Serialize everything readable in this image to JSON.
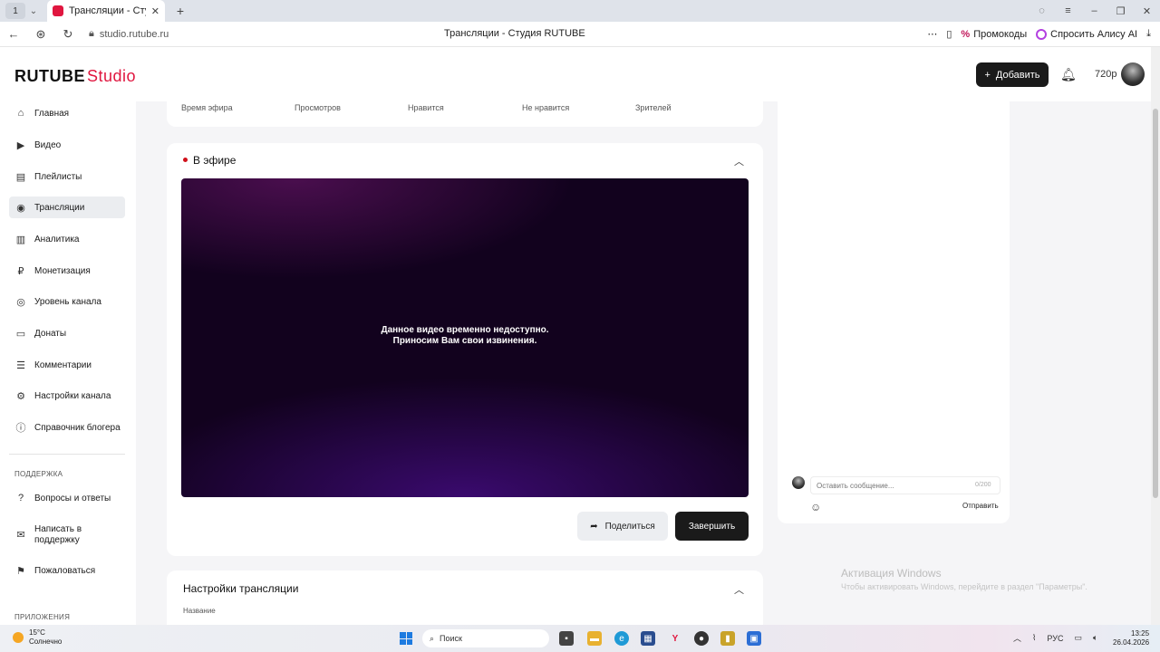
{
  "browser": {
    "tab_index": "1",
    "tab_title": "Трансляции - Студия R",
    "url": "studio.rutube.ru",
    "page_title": "Трансляции - Студия RUTUBE",
    "promo_label": "Промокоды",
    "alice_label": "Спросить Алису AI"
  },
  "header": {
    "logo_main": "RUTUBE",
    "logo_sub": "Studio",
    "add_label": "Добавить",
    "quality": "720p"
  },
  "sidebar": {
    "items": [
      {
        "label": "Главная",
        "icon": "home-icon"
      },
      {
        "label": "Видео",
        "icon": "video-icon"
      },
      {
        "label": "Плейлисты",
        "icon": "playlist-icon"
      },
      {
        "label": "Трансляции",
        "icon": "broadcast-icon"
      },
      {
        "label": "Аналитика",
        "icon": "analytics-icon"
      },
      {
        "label": "Монетизация",
        "icon": "monetization-icon"
      },
      {
        "label": "Уровень канала",
        "icon": "level-icon"
      },
      {
        "label": "Донаты",
        "icon": "donate-icon"
      },
      {
        "label": "Комментарии",
        "icon": "comment-icon"
      },
      {
        "label": "Настройки канала",
        "icon": "gear-icon"
      },
      {
        "label": "Справочник блогера",
        "icon": "help-icon"
      }
    ],
    "support_caption": "ПОДДЕРЖКА",
    "support_items": [
      {
        "label": "Вопросы и ответы",
        "icon": "question-icon"
      },
      {
        "label": "Написать в поддержку",
        "icon": "mail-icon"
      },
      {
        "label": "Пожаловаться",
        "icon": "flag-icon"
      }
    ],
    "apps_caption": "ПРИЛОЖЕНИЯ"
  },
  "stats": {
    "labels": [
      "Время эфира",
      "Просмотров",
      "Нравится",
      "Не нравится",
      "Зрителей"
    ]
  },
  "live": {
    "title": "В эфире",
    "player_line1": "Данное видео временно недоступно.",
    "player_line2": "Приносим Вам свои извинения.",
    "share_label": "Поделиться",
    "finish_label": "Завершить"
  },
  "settings": {
    "title": "Настройки трансляции",
    "name_label": "Название"
  },
  "chat": {
    "placeholder": "Оставить сообщение...",
    "counter": "0/200",
    "send_label": "Отправить"
  },
  "watermark": {
    "title": "Активация Windows",
    "subtitle": "Чтобы активировать Windows, перейдите в раздел \"Параметры\"."
  },
  "taskbar": {
    "temp": "15°C",
    "weather": "Солнечно",
    "search_label": "Поиск",
    "lang": "РУС",
    "time": "13:25",
    "date": "26.04.2026"
  },
  "colors": {
    "accent": "#e0163f",
    "live_dot": "#d0101a",
    "dark_button": "#1a1a1a"
  }
}
